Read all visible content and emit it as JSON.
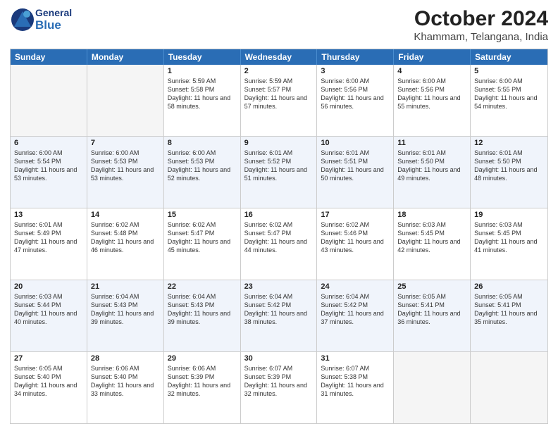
{
  "header": {
    "logo_general": "General",
    "logo_blue": "Blue",
    "month_title": "October 2024",
    "location": "Khammam, Telangana, India"
  },
  "weekdays": [
    "Sunday",
    "Monday",
    "Tuesday",
    "Wednesday",
    "Thursday",
    "Friday",
    "Saturday"
  ],
  "rows": [
    [
      {
        "day": "",
        "info": ""
      },
      {
        "day": "",
        "info": ""
      },
      {
        "day": "1",
        "info": "Sunrise: 5:59 AM\nSunset: 5:58 PM\nDaylight: 11 hours and 58 minutes."
      },
      {
        "day": "2",
        "info": "Sunrise: 5:59 AM\nSunset: 5:57 PM\nDaylight: 11 hours and 57 minutes."
      },
      {
        "day": "3",
        "info": "Sunrise: 6:00 AM\nSunset: 5:56 PM\nDaylight: 11 hours and 56 minutes."
      },
      {
        "day": "4",
        "info": "Sunrise: 6:00 AM\nSunset: 5:56 PM\nDaylight: 11 hours and 55 minutes."
      },
      {
        "day": "5",
        "info": "Sunrise: 6:00 AM\nSunset: 5:55 PM\nDaylight: 11 hours and 54 minutes."
      }
    ],
    [
      {
        "day": "6",
        "info": "Sunrise: 6:00 AM\nSunset: 5:54 PM\nDaylight: 11 hours and 53 minutes."
      },
      {
        "day": "7",
        "info": "Sunrise: 6:00 AM\nSunset: 5:53 PM\nDaylight: 11 hours and 53 minutes."
      },
      {
        "day": "8",
        "info": "Sunrise: 6:00 AM\nSunset: 5:53 PM\nDaylight: 11 hours and 52 minutes."
      },
      {
        "day": "9",
        "info": "Sunrise: 6:01 AM\nSunset: 5:52 PM\nDaylight: 11 hours and 51 minutes."
      },
      {
        "day": "10",
        "info": "Sunrise: 6:01 AM\nSunset: 5:51 PM\nDaylight: 11 hours and 50 minutes."
      },
      {
        "day": "11",
        "info": "Sunrise: 6:01 AM\nSunset: 5:50 PM\nDaylight: 11 hours and 49 minutes."
      },
      {
        "day": "12",
        "info": "Sunrise: 6:01 AM\nSunset: 5:50 PM\nDaylight: 11 hours and 48 minutes."
      }
    ],
    [
      {
        "day": "13",
        "info": "Sunrise: 6:01 AM\nSunset: 5:49 PM\nDaylight: 11 hours and 47 minutes."
      },
      {
        "day": "14",
        "info": "Sunrise: 6:02 AM\nSunset: 5:48 PM\nDaylight: 11 hours and 46 minutes."
      },
      {
        "day": "15",
        "info": "Sunrise: 6:02 AM\nSunset: 5:47 PM\nDaylight: 11 hours and 45 minutes."
      },
      {
        "day": "16",
        "info": "Sunrise: 6:02 AM\nSunset: 5:47 PM\nDaylight: 11 hours and 44 minutes."
      },
      {
        "day": "17",
        "info": "Sunrise: 6:02 AM\nSunset: 5:46 PM\nDaylight: 11 hours and 43 minutes."
      },
      {
        "day": "18",
        "info": "Sunrise: 6:03 AM\nSunset: 5:45 PM\nDaylight: 11 hours and 42 minutes."
      },
      {
        "day": "19",
        "info": "Sunrise: 6:03 AM\nSunset: 5:45 PM\nDaylight: 11 hours and 41 minutes."
      }
    ],
    [
      {
        "day": "20",
        "info": "Sunrise: 6:03 AM\nSunset: 5:44 PM\nDaylight: 11 hours and 40 minutes."
      },
      {
        "day": "21",
        "info": "Sunrise: 6:04 AM\nSunset: 5:43 PM\nDaylight: 11 hours and 39 minutes."
      },
      {
        "day": "22",
        "info": "Sunrise: 6:04 AM\nSunset: 5:43 PM\nDaylight: 11 hours and 39 minutes."
      },
      {
        "day": "23",
        "info": "Sunrise: 6:04 AM\nSunset: 5:42 PM\nDaylight: 11 hours and 38 minutes."
      },
      {
        "day": "24",
        "info": "Sunrise: 6:04 AM\nSunset: 5:42 PM\nDaylight: 11 hours and 37 minutes."
      },
      {
        "day": "25",
        "info": "Sunrise: 6:05 AM\nSunset: 5:41 PM\nDaylight: 11 hours and 36 minutes."
      },
      {
        "day": "26",
        "info": "Sunrise: 6:05 AM\nSunset: 5:41 PM\nDaylight: 11 hours and 35 minutes."
      }
    ],
    [
      {
        "day": "27",
        "info": "Sunrise: 6:05 AM\nSunset: 5:40 PM\nDaylight: 11 hours and 34 minutes."
      },
      {
        "day": "28",
        "info": "Sunrise: 6:06 AM\nSunset: 5:40 PM\nDaylight: 11 hours and 33 minutes."
      },
      {
        "day": "29",
        "info": "Sunrise: 6:06 AM\nSunset: 5:39 PM\nDaylight: 11 hours and 32 minutes."
      },
      {
        "day": "30",
        "info": "Sunrise: 6:07 AM\nSunset: 5:39 PM\nDaylight: 11 hours and 32 minutes."
      },
      {
        "day": "31",
        "info": "Sunrise: 6:07 AM\nSunset: 5:38 PM\nDaylight: 11 hours and 31 minutes."
      },
      {
        "day": "",
        "info": ""
      },
      {
        "day": "",
        "info": ""
      }
    ]
  ]
}
